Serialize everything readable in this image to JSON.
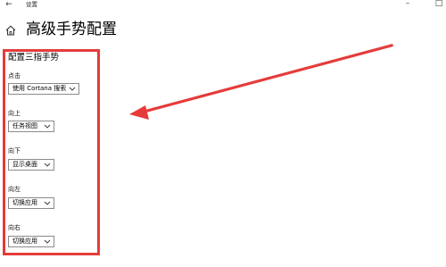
{
  "titlebar": {
    "back_glyph": "←",
    "title": "设置",
    "minimize_glyph": "–",
    "maximize_glyph": "□"
  },
  "header": {
    "icon": "home-icon",
    "title": "高级手势配置"
  },
  "panel": {
    "title": "配置三指手势",
    "highlight_color": "#e53b3b",
    "fields": [
      {
        "label": "点击",
        "value": "使用 Cortana 搜索"
      },
      {
        "label": "向上",
        "value": "任务视图"
      },
      {
        "label": "向下",
        "value": "显示桌面"
      },
      {
        "label": "向左",
        "value": "切换应用"
      },
      {
        "label": "向右",
        "value": "切换应用"
      }
    ]
  },
  "annotation": {
    "type": "arrow",
    "color": "#e53b3b"
  }
}
